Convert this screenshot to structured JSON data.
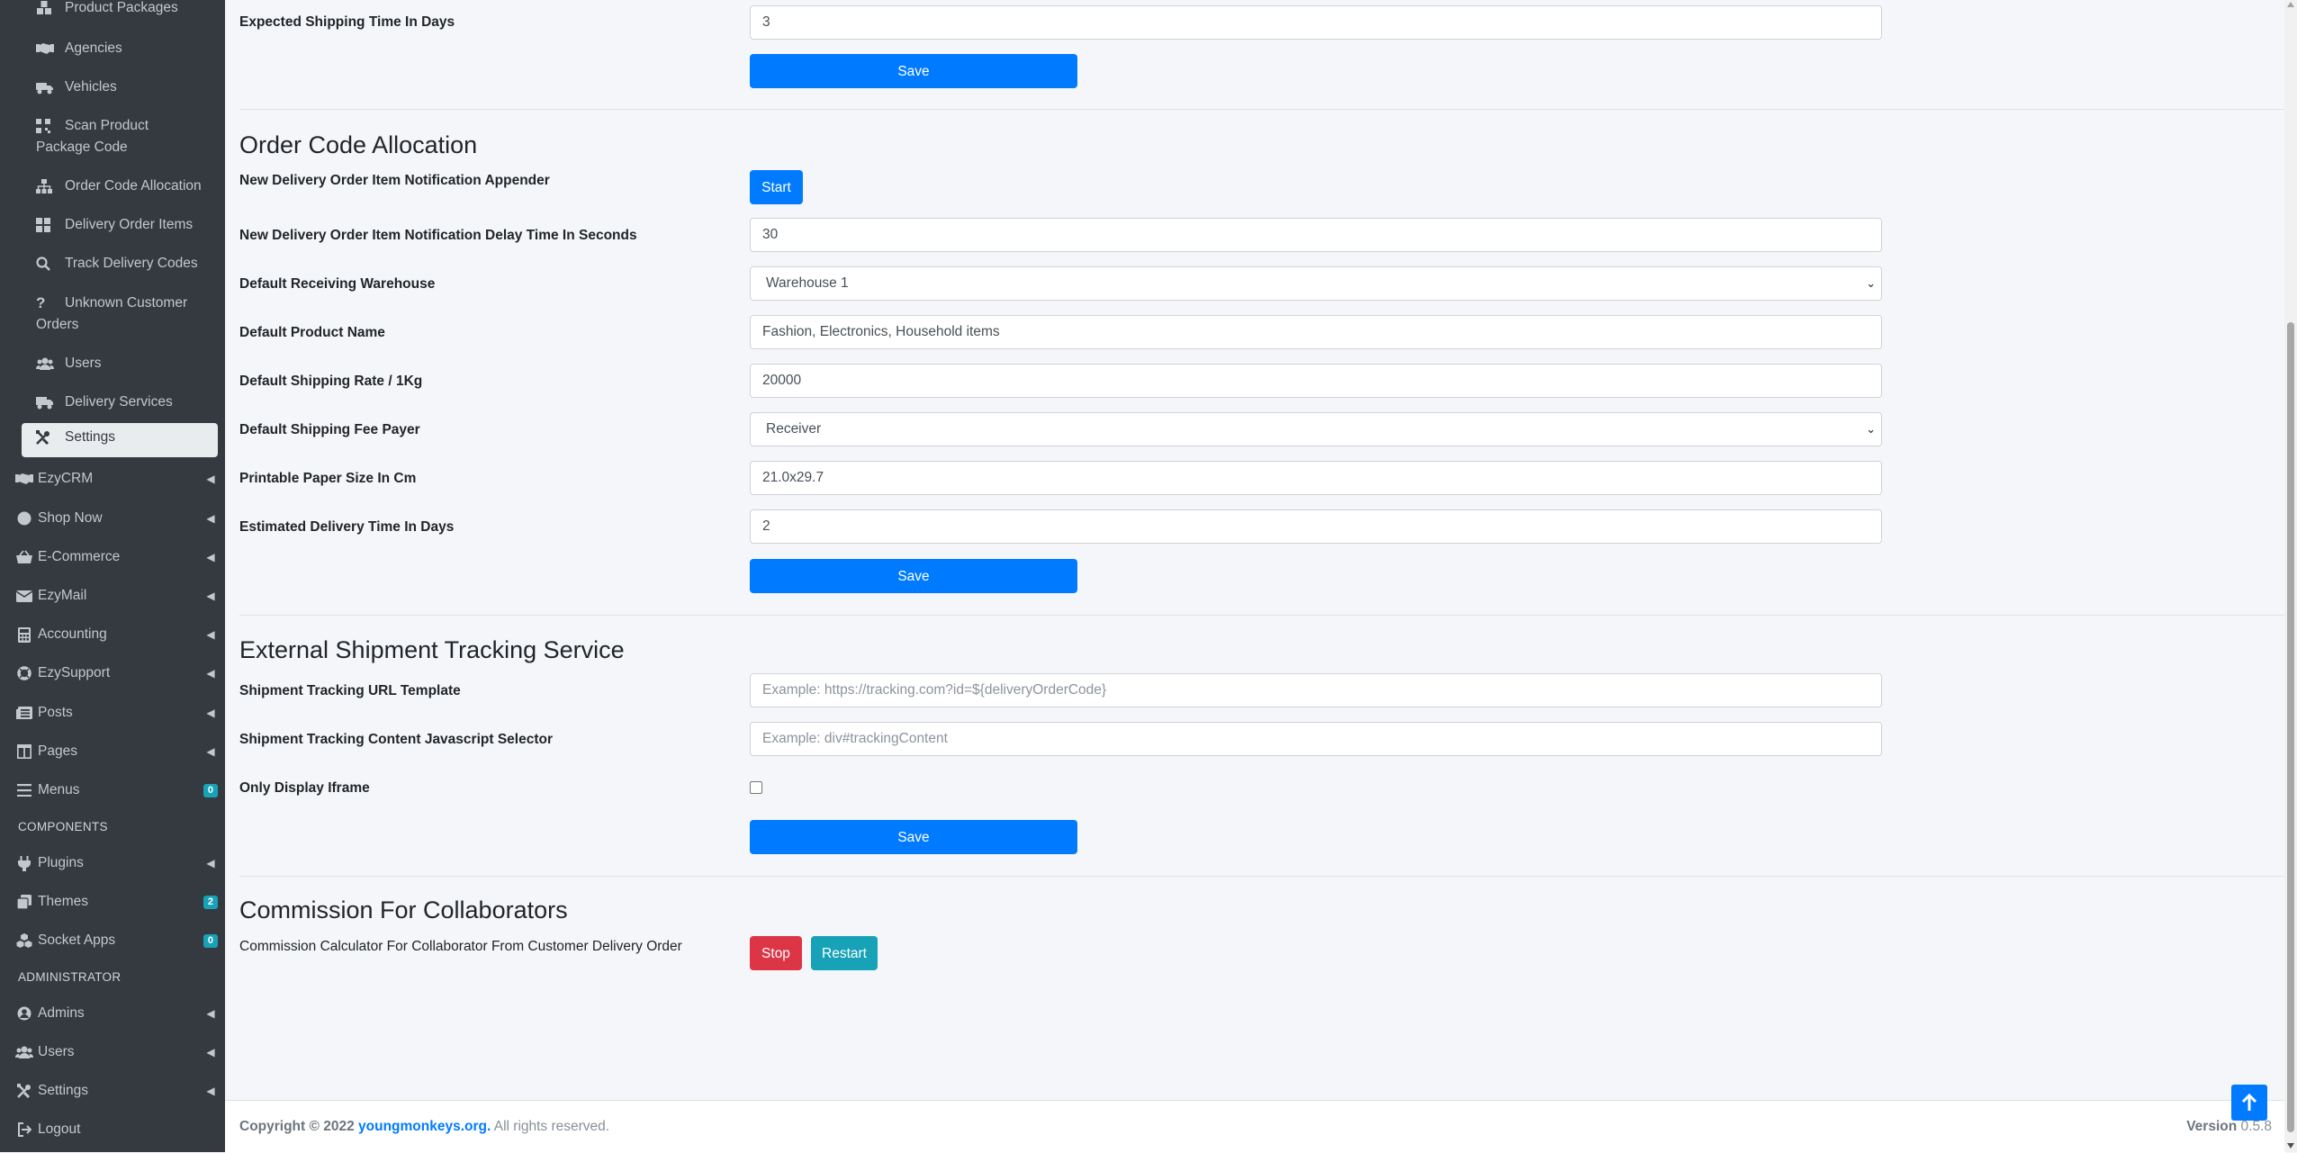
{
  "sidebar": {
    "sub_items": [
      {
        "label": "Product Packages",
        "icon": "boxes-icon"
      },
      {
        "label": "Agencies",
        "icon": "handshake-icon"
      },
      {
        "label": "Vehicles",
        "icon": "truck-icon"
      },
      {
        "label": "Scan Product Package Code",
        "icon": "qrcode-icon"
      },
      {
        "label": "Order Code Allocation",
        "icon": "sitemap-icon"
      },
      {
        "label": "Delivery Order Items",
        "icon": "th-large-icon"
      },
      {
        "label": "Track Delivery Codes",
        "icon": "search-icon"
      },
      {
        "label": "Unknown Customer Orders",
        "icon": "question-icon"
      },
      {
        "label": "Users",
        "icon": "users-icon"
      },
      {
        "label": "Delivery Services",
        "icon": "shipping-icon"
      },
      {
        "label": "Settings",
        "icon": "tools-icon"
      }
    ],
    "top_items": [
      {
        "label": "EzyCRM",
        "icon": "handshake-icon"
      },
      {
        "label": "Shop Now",
        "icon": "circle-icon"
      },
      {
        "label": "E-Commerce",
        "icon": "basket-icon"
      },
      {
        "label": "EzyMail",
        "icon": "envelope-icon"
      },
      {
        "label": "Accounting",
        "icon": "calculator-icon"
      },
      {
        "label": "EzySupport",
        "icon": "lifering-icon"
      },
      {
        "label": "Posts",
        "icon": "newspaper-icon"
      },
      {
        "label": "Pages",
        "icon": "columns-icon"
      },
      {
        "label": "Menus",
        "icon": "bars-icon",
        "badge": "0"
      }
    ],
    "components_header": "COMPONENTS",
    "components": [
      {
        "label": "Plugins",
        "icon": "plug-icon"
      },
      {
        "label": "Themes",
        "icon": "clone-icon",
        "badge": "2"
      },
      {
        "label": "Socket Apps",
        "icon": "cubes-icon",
        "badge": "0"
      }
    ],
    "administrator_header": "ADMINISTRATOR",
    "administrator": [
      {
        "label": "Admins",
        "icon": "user-circle-icon"
      },
      {
        "label": "Users",
        "icon": "users-icon"
      },
      {
        "label": "Settings",
        "icon": "tools-icon"
      },
      {
        "label": "Logout",
        "icon": "logout-icon"
      }
    ]
  },
  "shipping_time": {
    "label": "Expected Shipping Time In Days",
    "value": "3",
    "save": "Save"
  },
  "order_code": {
    "title": "Order Code Allocation",
    "appender_label": "New Delivery Order Item Notification Appender",
    "start": "Start",
    "delay_label": "New Delivery Order Item Notification Delay Time In Seconds",
    "delay_value": "30",
    "warehouse_label": "Default Receiving Warehouse",
    "warehouse_value": "Warehouse 1",
    "product_label": "Default Product Name",
    "product_value": "Fashion, Electronics, Household items",
    "rate_label": "Default Shipping Rate / 1Kg",
    "rate_value": "20000",
    "payer_label": "Default Shipping Fee Payer",
    "payer_value": "Receiver",
    "paper_label": "Printable Paper Size In Cm",
    "paper_value": "21.0x29.7",
    "delivery_label": "Estimated Delivery Time In Days",
    "delivery_value": "2",
    "save": "Save"
  },
  "tracking": {
    "title": "External Shipment Tracking Service",
    "url_label": "Shipment Tracking URL Template",
    "url_placeholder": "Example: https://tracking.com?id=${deliveryOrderCode}",
    "selector_label": "Shipment Tracking Content Javascript Selector",
    "selector_placeholder": "Example: div#trackingContent",
    "iframe_label": "Only Display Iframe",
    "save": "Save"
  },
  "commission": {
    "title": "Commission For Collaborators",
    "calculator_label": "Commission Calculator For Collaborator From Customer Delivery Order",
    "stop": "Stop",
    "restart": "Restart"
  },
  "footer": {
    "copyright": "Copyright © 2022",
    "link": "youngmonkeys.org.",
    "rights": "All rights reserved.",
    "version_label": "Version",
    "version_value": "0.5.8"
  },
  "colors": {
    "sidebar_bg": "#343a40",
    "primary": "#007bff",
    "danger": "#dc3545",
    "info": "#17a2b8"
  }
}
